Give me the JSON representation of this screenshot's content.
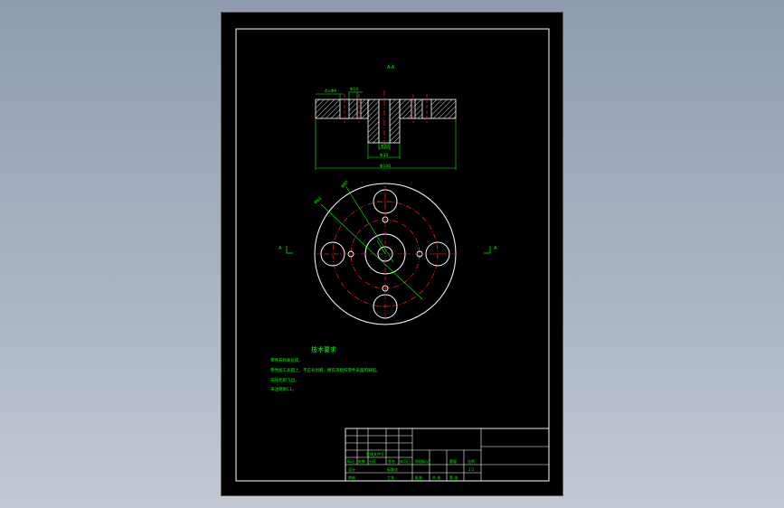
{
  "sheet": {
    "section_label": "A-A",
    "view_marker_left": "A",
    "view_marker_right": "A"
  },
  "section_view": {
    "dim_top_left": "4×Φ9",
    "dim_top_mid": "Φ10",
    "dim_inner_small": "Φ20",
    "dim_inner_bottom": "Φ30",
    "dim_overall": "Φ100"
  },
  "plan_view": {
    "leader_label_1": "Φ60",
    "leader_label_2": "Φ80"
  },
  "notes": {
    "heading": "技术要求",
    "lines": [
      "零件去除氧化皮。",
      "零件加工表面上，不应有划痕、擦伤等损伤零件表面的缺陷。",
      "去除毛刺飞边。",
      "未注倒角C1。"
    ]
  },
  "title_block": {
    "cells": [
      "标记",
      "处数",
      "分区",
      "更改文件号",
      "签名",
      "年月日",
      "设计",
      "标准化",
      "阶段标记",
      "重量",
      "比例",
      "审核",
      "工艺",
      "批准",
      "共 张",
      "第 张",
      "1:1"
    ]
  },
  "colors": {
    "frame": "#ffffff",
    "geometry": "#ffffff",
    "centerline": "#ff2020",
    "dimension": "#00ff00",
    "hatch": "#ffffff"
  }
}
